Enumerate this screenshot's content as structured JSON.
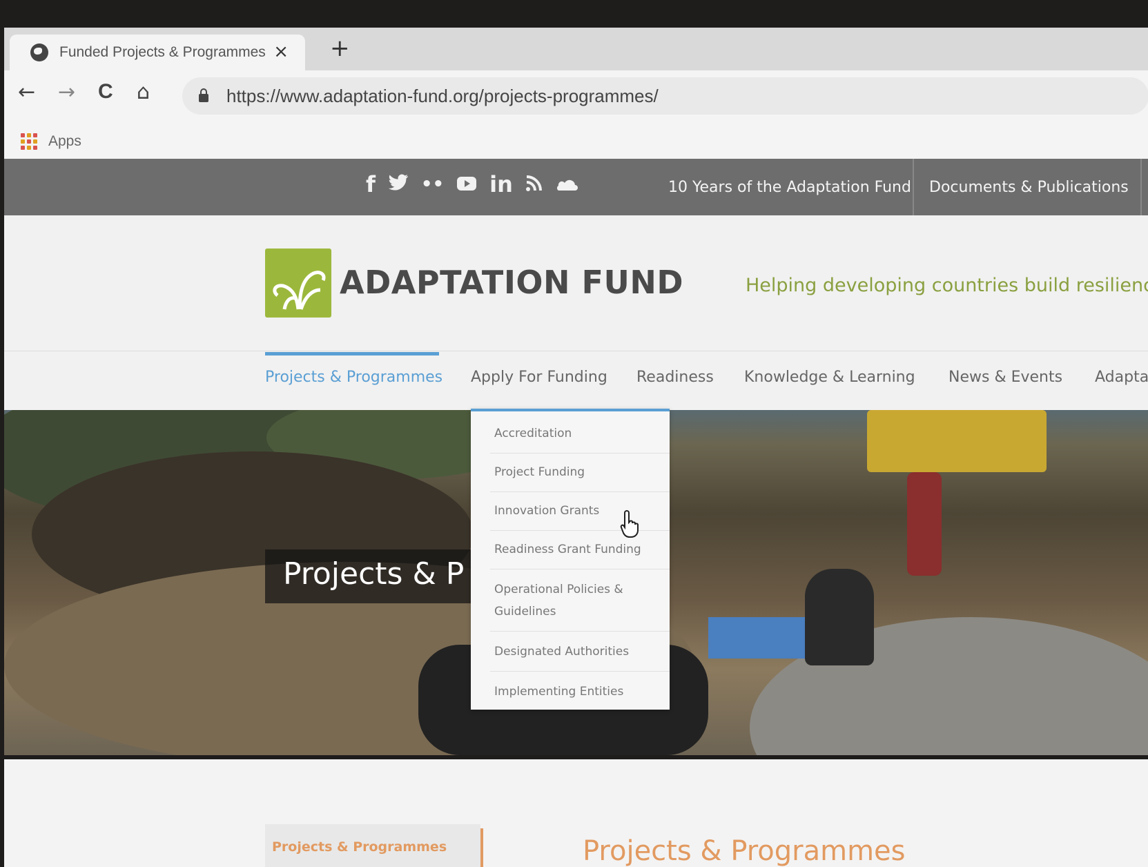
{
  "browser": {
    "tab_title": "Funded Projects & Programmes",
    "tab_close": "×",
    "new_tab": "+",
    "url": "https://www.adaptation-fund.org/projects-programmes/",
    "nav": {
      "back": "←",
      "forward": "→",
      "reload": "C",
      "home": "⌂"
    },
    "bookmarks": [
      {
        "label": "Apps"
      }
    ]
  },
  "site": {
    "social_icons": [
      {
        "name": "facebook-icon",
        "glyph": "f"
      },
      {
        "name": "twitter-icon",
        "glyph": "🐦"
      },
      {
        "name": "flickr-icon",
        "glyph": "••"
      },
      {
        "name": "youtube-icon",
        "glyph": "▶"
      },
      {
        "name": "linkedin-icon",
        "glyph": "in"
      },
      {
        "name": "rss-icon",
        "glyph": "⌇"
      },
      {
        "name": "soundcloud-icon",
        "glyph": "☁"
      }
    ],
    "top_links": [
      "10 Years of the Adaptation Fund",
      "Documents & Publications"
    ],
    "logo_text": "ADAPTATION FUND",
    "tagline": "Helping developing countries build resilience a",
    "main_nav": [
      "Projects & Programmes",
      "Apply For Funding",
      "Readiness",
      "Knowledge & Learning",
      "News & Events",
      "Adapta"
    ],
    "active_nav": "Projects & Programmes",
    "colors": {
      "accent_blue": "#5a9fd4",
      "logo_green": "#9cb83c",
      "heading_orange": "#e29a60",
      "topbar_gray": "#6d6d6d"
    }
  },
  "dropdown": {
    "parent": "Apply For Funding",
    "items": [
      {
        "label": "Accreditation"
      },
      {
        "label": "Project Funding"
      },
      {
        "label": "Innovation Grants"
      },
      {
        "label": "Readiness Grant Funding"
      },
      {
        "label": "Operational Policies &",
        "label2": "Guidelines"
      },
      {
        "label": "Designated Authorities"
      },
      {
        "label": "Implementing Entities"
      }
    ]
  },
  "hero": {
    "title": "Projects & P"
  },
  "content": {
    "side_tab": "Projects & Programmes",
    "heading": "Projects & Programmes"
  }
}
